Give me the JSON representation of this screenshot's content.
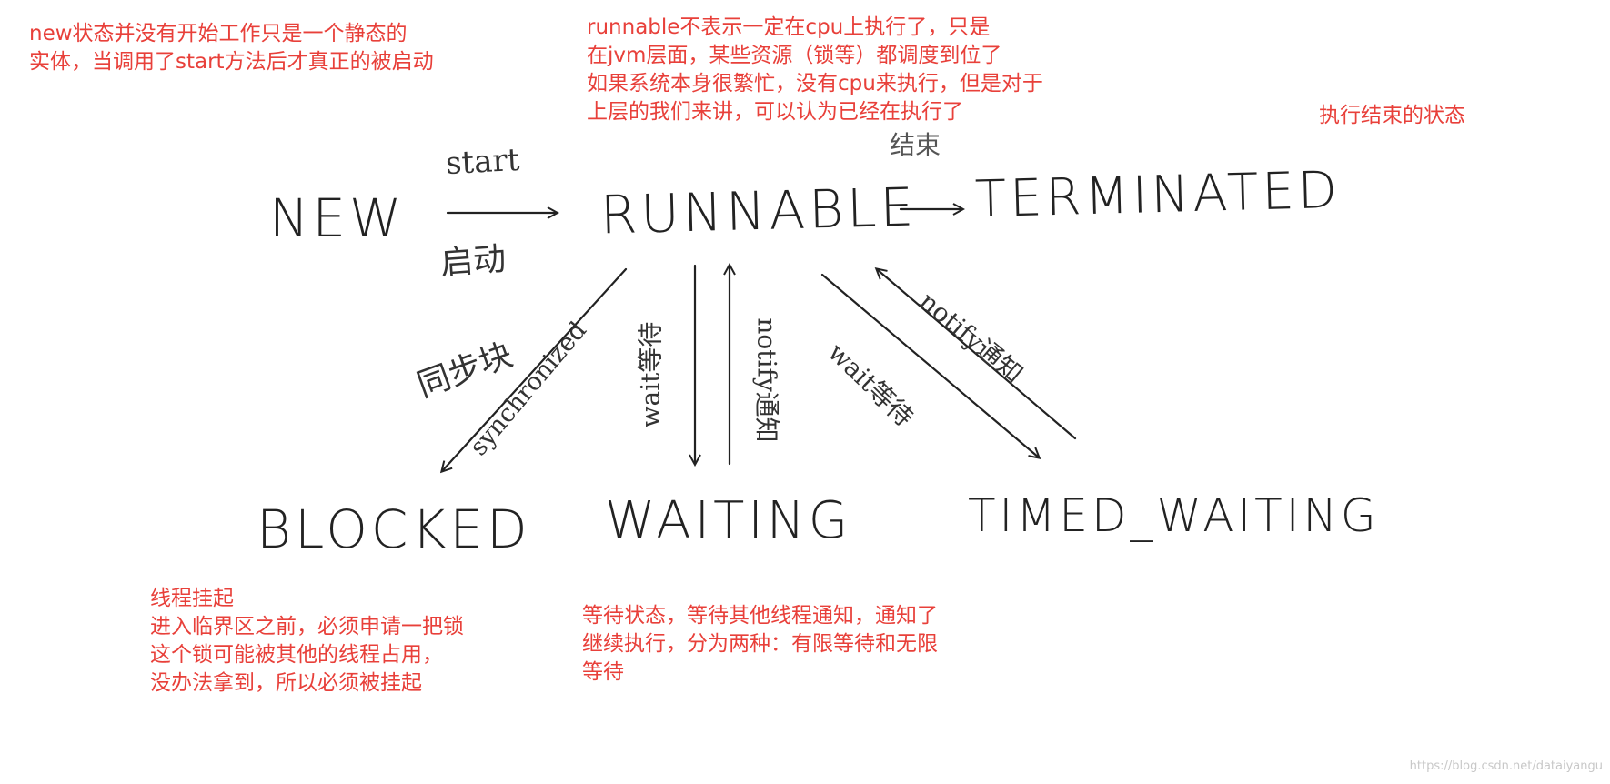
{
  "notes": {
    "new_note": [
      "new状态并没有开始工作只是一个静态的",
      "实体，当调用了start方法后才真正的被启动"
    ],
    "runnable_note": [
      "runnable不表示一定在cpu上执行了，只是",
      "在jvm层面，某些资源（锁等）都调度到位了",
      "如果系统本身很繁忙，没有cpu来执行，但是对于",
      "上层的我们来讲，可以认为已经在执行了"
    ],
    "terminated_note": [
      "执行结束的状态"
    ],
    "blocked_note": [
      "线程挂起",
      "进入临界区之前，必须申请一把锁",
      "这个锁可能被其他的线程占用，",
      "没办法拿到，所以必须被挂起"
    ],
    "waiting_note": [
      "等待状态，等待其他线程通知，通知了",
      "继续执行，分为两种：有限等待和无限",
      "等待"
    ]
  },
  "states": {
    "new": "NEW",
    "runnable": "RUNNABLE",
    "terminated": "TERMINATED",
    "blocked": "BLOCKED",
    "waiting": "WAITING",
    "timed_waiting": "TIMED_WAITING"
  },
  "edges": {
    "start_en": "start",
    "start_cn": "启动",
    "end_cn": "结束",
    "sync_cn": "同步块",
    "sync_en": "synchronized",
    "wait_en_cn": "wait等待",
    "notify_en_cn": "notify通知",
    "timed_wait": "wait等待",
    "timed_notify": "notify通知"
  },
  "watermark": "https://blog.csdn.net/dataiyangu",
  "colors": {
    "note": "#e8403a",
    "ink": "#222222"
  }
}
